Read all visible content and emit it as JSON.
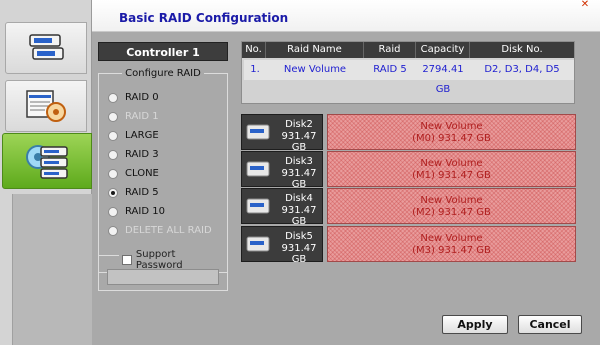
{
  "window": {
    "title": "Basic RAID Configuration",
    "close_glyph": "✕"
  },
  "rail": {
    "tabs": [
      {
        "icon": "disk-list-icon"
      },
      {
        "icon": "drive-gauge-icon"
      },
      {
        "icon": "raid-gear-icon",
        "active": true
      }
    ]
  },
  "controller": {
    "label": "Controller 1"
  },
  "raid_group": {
    "legend": "Configure RAID",
    "options": [
      {
        "label": "RAID 0",
        "enabled": true,
        "selected": false
      },
      {
        "label": "RAID 1",
        "enabled": false,
        "selected": false
      },
      {
        "label": "LARGE",
        "enabled": true,
        "selected": false
      },
      {
        "label": "RAID 3",
        "enabled": true,
        "selected": false
      },
      {
        "label": "CLONE",
        "enabled": true,
        "selected": false
      },
      {
        "label": "RAID 5",
        "enabled": true,
        "selected": true
      },
      {
        "label": "RAID 10",
        "enabled": true,
        "selected": false
      },
      {
        "label": "DELETE ALL RAID",
        "enabled": false,
        "selected": false
      }
    ]
  },
  "password": {
    "label": "Support Password",
    "checked": false,
    "value": ""
  },
  "table": {
    "columns": [
      "No.",
      "Raid Name",
      "Raid Level",
      "Capacity",
      "Disk No."
    ],
    "rows": [
      {
        "no": "1.",
        "name": "New Volume",
        "level": "RAID 5",
        "capacity": "2794.41 GB",
        "disks": "D2, D3, D4, D5"
      }
    ]
  },
  "disks": [
    {
      "name": "Disk2",
      "size": "931.47 GB",
      "volume": "New Volume",
      "member": "(M0) 931.47 GB"
    },
    {
      "name": "Disk3",
      "size": "931.47 GB",
      "volume": "New Volume",
      "member": "(M1) 931.47 GB"
    },
    {
      "name": "Disk4",
      "size": "931.47 GB",
      "volume": "New Volume",
      "member": "(M2) 931.47 GB"
    },
    {
      "name": "Disk5",
      "size": "931.47 GB",
      "volume": "New Volume",
      "member": "(M3) 931.47 GB"
    }
  ],
  "buttons": {
    "apply": "Apply",
    "cancel": "Cancel"
  },
  "colors": {
    "accent": "#1b1ba8",
    "member_fill": "#e99c9c",
    "member_text": "#b02020",
    "active_tab": "#7cc33a"
  }
}
